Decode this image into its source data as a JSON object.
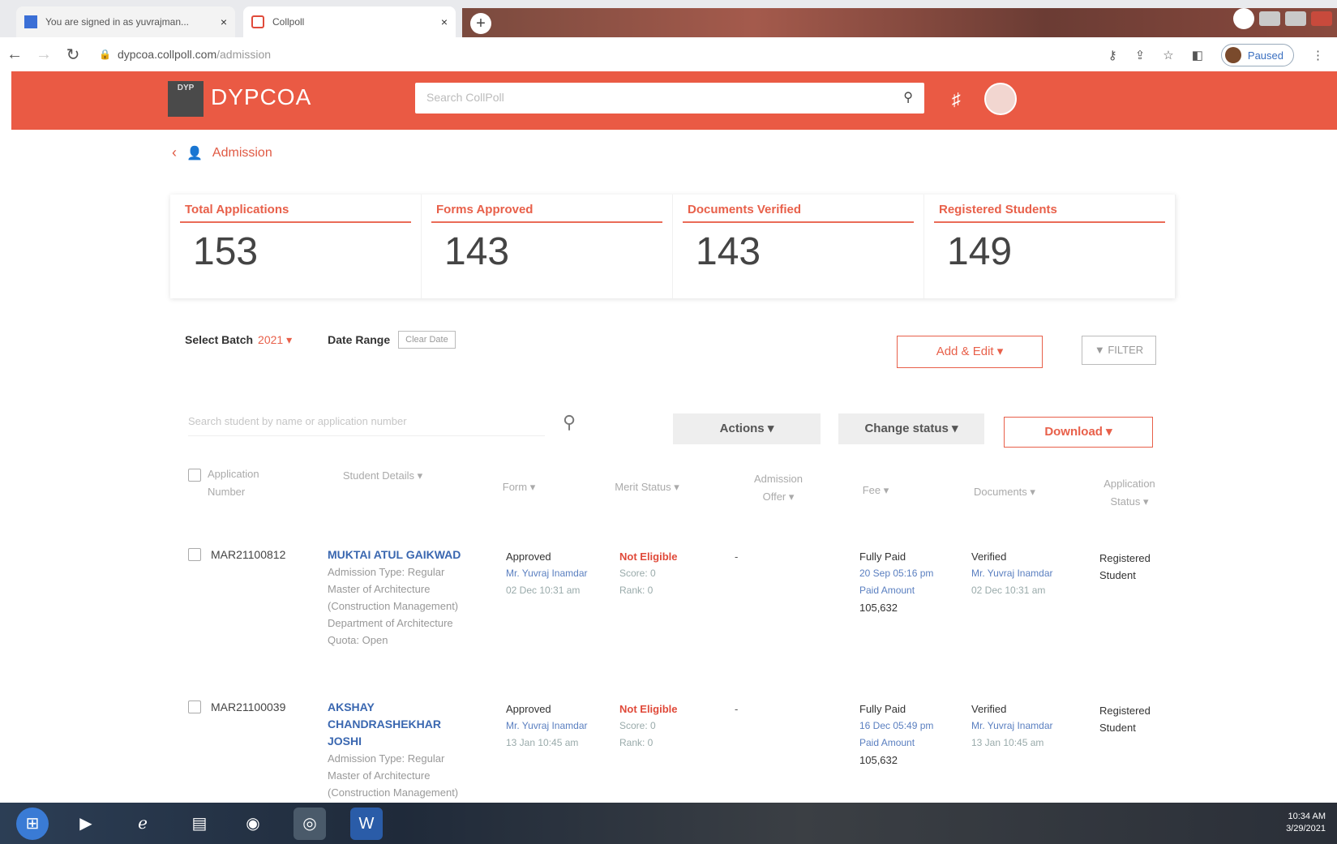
{
  "browser": {
    "tabs": [
      {
        "title": "You are signed in as yuvrajman..."
      },
      {
        "title": "Collpoll"
      }
    ],
    "url_host": "dypcoa.collpoll.com",
    "url_path": "/admission",
    "profile_label": "Paused"
  },
  "header": {
    "logo_text": "DYP",
    "brand": "DYPCOA",
    "search_placeholder": "Search CollPoll"
  },
  "breadcrumb": {
    "label": "Admission"
  },
  "stats": [
    {
      "label": "Total Applications",
      "value": "153"
    },
    {
      "label": "Forms Approved",
      "value": "143"
    },
    {
      "label": "Documents Verified",
      "value": "143"
    },
    {
      "label": "Registered Students",
      "value": "149"
    }
  ],
  "filters": {
    "batch_label": "Select Batch",
    "batch_value": "2021 ▾",
    "date_range_label": "Date Range",
    "clear_date": "Clear Date",
    "add_edit": "Add & Edit ▾",
    "filter": "▼ FILTER"
  },
  "toolbar": {
    "search_placeholder": "Search student by name or application number",
    "actions": "Actions ▾",
    "change_status": "Change status ▾",
    "download": "Download ▾"
  },
  "table": {
    "columns": {
      "app_no": "Application Number",
      "student": "Student Details ▾",
      "form": "Form ▾",
      "merit": "Merit Status ▾",
      "offer": "Admission Offer ▾",
      "fee": "Fee ▾",
      "documents": "Documents ▾",
      "app_status": "Application Status ▾"
    },
    "rows": [
      {
        "app_no": "MAR21100812",
        "name": "MUKTAI ATUL GAIKWAD",
        "details": [
          "Admission Type: Regular",
          "Master of Architecture",
          "(Construction Management)",
          "Department of Architecture",
          "Quota: Open"
        ],
        "form_status": "Approved",
        "form_by": "Mr. Yuvraj Inamdar",
        "form_date": "02 Dec 10:31 am",
        "merit_status": "Not Eligible",
        "merit_score": "Score: 0",
        "merit_rank": "Rank: 0",
        "offer": "-",
        "fee_status": "Fully Paid",
        "fee_date": "20 Sep 05:16 pm",
        "fee_label": "Paid Amount",
        "fee_amount": "105,632",
        "doc_status": "Verified",
        "doc_by": "Mr. Yuvraj Inamdar",
        "doc_date": "02 Dec 10:31 am",
        "app_status": "Registered Student"
      },
      {
        "app_no": "MAR21100039",
        "name": "AKSHAY CHANDRASHEKHAR JOSHI",
        "details": [
          "Admission Type: Regular",
          "Master of Architecture",
          "(Construction Management)"
        ],
        "form_status": "Approved",
        "form_by": "Mr. Yuvraj Inamdar",
        "form_date": "13 Jan 10:45 am",
        "merit_status": "Not Eligible",
        "merit_score": "Score: 0",
        "merit_rank": "Rank: 0",
        "offer": "-",
        "fee_status": "Fully Paid",
        "fee_date": "16 Dec 05:49 pm",
        "fee_label": "Paid Amount",
        "fee_amount": "105,632",
        "doc_status": "Verified",
        "doc_by": "Mr. Yuvraj Inamdar",
        "doc_date": "13 Jan 10:45 am",
        "app_status": "Registered Student"
      }
    ]
  },
  "taskbar": {
    "time": "10:34 AM",
    "date": "3/29/2021"
  }
}
